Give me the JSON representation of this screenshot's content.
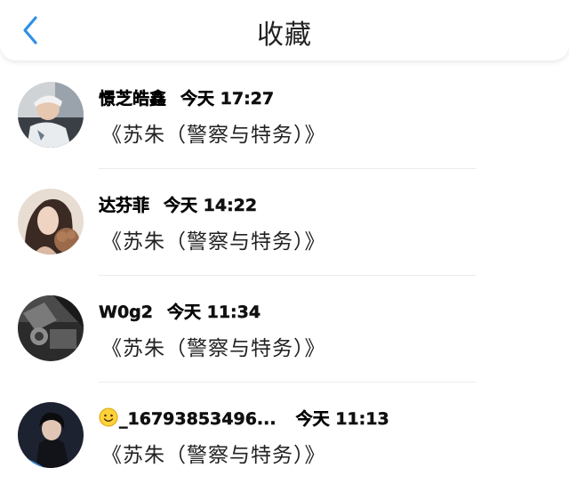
{
  "header": {
    "title": "收藏",
    "back_icon": "chevron-left-icon",
    "accent_color": "#2f8fe8"
  },
  "items": [
    {
      "username": "憬芝皓鑫",
      "time": "今天 17:27",
      "content": "《苏朱（警察与特务）》",
      "avatar": "person-photo"
    },
    {
      "username": "达芬菲",
      "time": "今天 14:22",
      "content": "《苏朱（警察与特务）》",
      "avatar": "person-photo"
    },
    {
      "username": "W0g2",
      "time": "今天 11:34",
      "content": "《苏朱（警察与特务）》",
      "avatar": "person-photo"
    },
    {
      "username": "_16793853496...",
      "time": "今天 11:13",
      "content": "《苏朱（警察与特务）》",
      "avatar": "person-photo",
      "emoji": "smiley-emoji-icon"
    }
  ]
}
